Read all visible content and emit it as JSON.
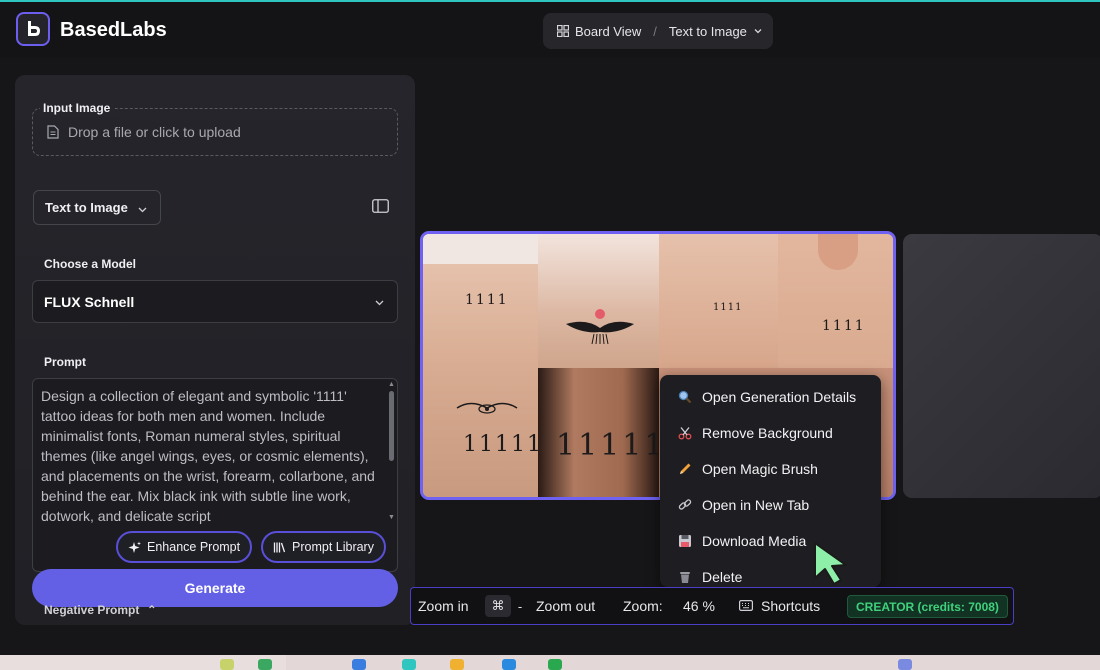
{
  "app": {
    "brand": "BasedLabs"
  },
  "breadcrumb": {
    "board": "Board View",
    "separator": "/",
    "current": "Text to Image"
  },
  "panel": {
    "input_image_label": "Input Image",
    "upload_placeholder": "Drop a file or click to upload",
    "mode_select": "Text to Image",
    "choose_model_label": "Choose a Model",
    "model": "FLUX Schnell",
    "prompt_label": "Prompt",
    "prompt_text": "Design a collection of elegant and symbolic '1111' tattoo ideas for both men and women. Include minimalist fonts, Roman numeral styles, spiritual themes (like angel wings, eyes, or cosmic elements), and placements on the wrist, forearm, collarbone, and behind the ear. Mix black ink with subtle line work, dotwork, and delicate script",
    "enhance_prompt": "Enhance Prompt",
    "prompt_library": "Prompt Library",
    "generate": "Generate",
    "negative_prompt_label": "Negative Prompt"
  },
  "image_tiles": {
    "wrist": "1111",
    "forearm": "11111",
    "dark_arm": "11111",
    "collarbone": "1111",
    "neck": "1111"
  },
  "context_menu": [
    {
      "icon": "magnifier-icon",
      "label": "Open Generation Details"
    },
    {
      "icon": "scissors-icon",
      "label": "Remove Background"
    },
    {
      "icon": "pencil-icon",
      "label": "Open Magic Brush"
    },
    {
      "icon": "link-icon",
      "label": "Open in New Tab"
    },
    {
      "icon": "floppy-icon",
      "label": "Download Media"
    },
    {
      "icon": "trash-icon",
      "label": "Delete"
    }
  ],
  "toolbar": {
    "zoom_in": "Zoom in",
    "cmd_key": "⌘",
    "minus_key": "-",
    "zoom_out": "Zoom out",
    "zoom_label": "Zoom:",
    "zoom_value": "46 %",
    "shortcuts": "Shortcuts",
    "credits": "CREATOR (credits: 7008)"
  },
  "colors": {
    "accent": "#6460e6",
    "selection_border": "#6f62f2",
    "credits_green": "#3fd17c",
    "background": "#161618"
  }
}
